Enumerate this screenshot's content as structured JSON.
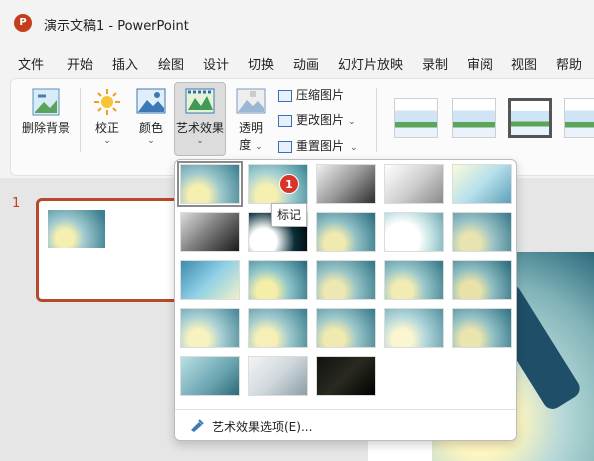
{
  "app": {
    "logo_letter": "P",
    "title": "演示文稿1  -  PowerPoint"
  },
  "menu": [
    "文件",
    "开始",
    "插入",
    "绘图",
    "设计",
    "切换",
    "动画",
    "幻灯片放映",
    "录制",
    "审阅",
    "视图",
    "帮助"
  ],
  "ribbon": {
    "remove_bg": "删除背景",
    "corrections": "校正",
    "color": "颜色",
    "artistic": "艺术效果",
    "transparency_1": "透明",
    "transparency_2": "度",
    "compress": "压缩图片",
    "change": "更改图片",
    "reset": "重置图片"
  },
  "slide_panel": {
    "slide_number": "1"
  },
  "artistic_menu": {
    "badge": "1",
    "tooltip": "标记",
    "options_label": "艺术效果选项(E)...",
    "effects": [
      {
        "name": "none",
        "bg": "radial-gradient(circle at 30% 80%,#f6f0b0 0 20%,#9cc8cc 45%,#3f8293 95%)"
      },
      {
        "name": "marker",
        "bg": "radial-gradient(circle at 30% 80%,#f6f0b0 0 20%,#a8d3d6 45%,#3f8a9a 95%)"
      },
      {
        "name": "pencil-grayscale",
        "bg": "linear-gradient(135deg,#f0f0f0,#9a9a9a 50%,#2e2e2e)"
      },
      {
        "name": "pencil-sketch",
        "bg": "linear-gradient(135deg,#ffffff,#d0d0d0 50%,#8a8a8a)"
      },
      {
        "name": "line-drawing",
        "bg": "linear-gradient(135deg,#fafad8,#b8e0ec 50%,#5ea0b8)"
      },
      {
        "name": "chalk-sketch",
        "bg": "linear-gradient(135deg,#dcdcdc,#6e6e6e 55%,#1a1a1a)"
      },
      {
        "name": "paint-strokes",
        "bg": "radial-gradient(circle at 25% 75%,#ffffff 0 25%,#0a2f3a 60%,#000 95%)"
      },
      {
        "name": "paint-brush",
        "bg": "radial-gradient(circle at 30% 80%,#f0eab0 0 20%,#8fbfc4 45%,#2f7283 95%)"
      },
      {
        "name": "glow-diffused",
        "bg": "radial-gradient(circle at 30% 70%,#ffffff 0 35%,#c4e2e4 60%,#7aaeb8 95%)"
      },
      {
        "name": "blur",
        "bg": "radial-gradient(circle at 30% 80%,#e8e4b0 0 20%,#9ac3c6 45%,#3d7e8e 95%)"
      },
      {
        "name": "mosaic-bubbles",
        "bg": "linear-gradient(135deg,#3c8cb0,#8fd0e6 50%,#f0f0c8)"
      },
      {
        "name": "glass",
        "bg": "radial-gradient(circle at 30% 80%,#f4eea8 0 20%,#8cc4cb 45%,#2c6f81 95%)"
      },
      {
        "name": "cement",
        "bg": "radial-gradient(circle at 30% 80%,#eee8b0 0 20%,#94c2c6 45%,#377a8b 95%)"
      },
      {
        "name": "texturizer",
        "bg": "radial-gradient(circle at 30% 80%,#f2ecb4 0 20%,#98c6ca 45%,#3a7c8c 95%)"
      },
      {
        "name": "crisscross-etching",
        "bg": "radial-gradient(circle at 30% 80%,#e8e2a8 0 20%,#8cbcc2 45%,#2d6f80 95%)"
      },
      {
        "name": "pastels-smooth",
        "bg": "radial-gradient(circle at 30% 80%,#f8f2c0 0 20%,#a8d0d4 45%,#4a8a9a 95%)"
      },
      {
        "name": "plastic-wrap",
        "bg": "radial-gradient(circle at 30% 80%,#f6f0b8 0 20%,#9ecacd 45%,#3f8292 95%)"
      },
      {
        "name": "cutout",
        "bg": "radial-gradient(circle at 30% 80%,#f0eab0 0 20%,#9ac6ca 45%,#3d7e8e 95%)"
      },
      {
        "name": "photocopy",
        "bg": "radial-gradient(circle at 30% 80%,#fbf6d0 0 20%,#b4d8dc 45%,#5c98a6 95%)"
      },
      {
        "name": "film-grain",
        "bg": "radial-gradient(circle at 30% 80%,#eae4ae 0 20%,#92c0c4 45%,#34778a 95%)"
      },
      {
        "name": "light-screen",
        "bg": "linear-gradient(135deg,#b8e0e4,#6aa4b0 60%,#2c6a7a)"
      },
      {
        "name": "watercolor-sponge",
        "bg": "linear-gradient(135deg,#f4f4f4,#d0d8dc 50%,#8a9ea6)"
      },
      {
        "name": "glow-edges",
        "bg": "linear-gradient(135deg,#101010,#2a2a20 50%,#000)"
      }
    ]
  }
}
